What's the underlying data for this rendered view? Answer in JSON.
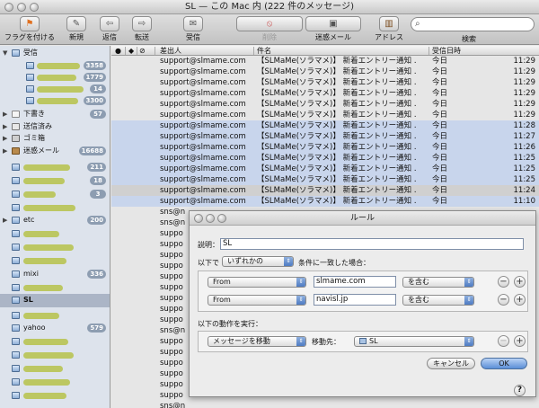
{
  "window": {
    "title": "SL — この Mac 内 (222 件のメッセージ)"
  },
  "toolbar": {
    "flag": "フラグを付ける",
    "new": "新規",
    "reply": "返信",
    "forward": "転送",
    "get_mail": "受信",
    "delete": "削除",
    "junk": "迷惑メール",
    "address": "アドレス",
    "search": "検索"
  },
  "sidebar": {
    "inbox": {
      "label": "受信",
      "accounts": [
        {
          "count": "3358"
        },
        {
          "count": "1779"
        },
        {
          "count": "14"
        },
        {
          "count": "3300"
        }
      ]
    },
    "drafts": {
      "label": "下書き",
      "count": "57"
    },
    "sent": {
      "label": "送信済み"
    },
    "trash": {
      "label": "ゴミ箱"
    },
    "junk": {
      "label": "迷惑メール",
      "count": "16688"
    },
    "folders": [
      {
        "count": "211"
      },
      {
        "count": "18"
      },
      {
        "count": "3"
      },
      {
        "label": "etc",
        "count": "200"
      },
      {
        "label": "mixi",
        "count": "336"
      },
      {
        "label": "SL"
      },
      {
        "label": "yahoo",
        "count": "579"
      }
    ]
  },
  "list": {
    "headers": {
      "from": "差出人",
      "subject": "件名",
      "date": "受信日時"
    },
    "rows": [
      {
        "from": "support@slmame.com",
        "subject": "【SLMaMe(ソラマメ)】 新着エントリー通知 …",
        "date": "今日",
        "time": "11:29"
      },
      {
        "from": "support@slmame.com",
        "subject": "【SLMaMe(ソラマメ)】 新着エントリー通知 …",
        "date": "今日",
        "time": "11:29"
      },
      {
        "from": "support@slmame.com",
        "subject": "【SLMaMe(ソラマメ)】 新着エントリー通知 …",
        "date": "今日",
        "time": "11:29"
      },
      {
        "from": "support@slmame.com",
        "subject": "【SLMaMe(ソラマメ)】 新着エントリー通知 …",
        "date": "今日",
        "time": "11:29"
      },
      {
        "from": "support@slmame.com",
        "subject": "【SLMaMe(ソラマメ)】 新着エントリー通知 …",
        "date": "今日",
        "time": "11:29"
      },
      {
        "from": "support@slmame.com",
        "subject": "【SLMaMe(ソラマメ)】 新着エントリー通知 …",
        "date": "今日",
        "time": "11:29"
      },
      {
        "from": "support@slmame.com",
        "subject": "【SLMaMe(ソラマメ)】 新着エントリー通知 …",
        "date": "今日",
        "time": "11:28"
      },
      {
        "from": "support@slmame.com",
        "subject": "【SLMaMe(ソラマメ)】 新着エントリー通知 …",
        "date": "今日",
        "time": "11:27"
      },
      {
        "from": "support@slmame.com",
        "subject": "【SLMaMe(ソラマメ)】 新着エントリー通知 …",
        "date": "今日",
        "time": "11:26"
      },
      {
        "from": "support@slmame.com",
        "subject": "【SLMaMe(ソラマメ)】 新着エントリー通知 …",
        "date": "今日",
        "time": "11:25"
      },
      {
        "from": "support@slmame.com",
        "subject": "【SLMaMe(ソラマメ)】 新着エントリー通知 …",
        "date": "今日",
        "time": "11:25"
      },
      {
        "from": "support@slmame.com",
        "subject": "【SLMaMe(ソラマメ)】 新着エントリー通知 …",
        "date": "今日",
        "time": "11:25"
      },
      {
        "from": "support@slmame.com",
        "subject": "【SLMaMe(ソラマメ)】 新着エントリー通知 …",
        "date": "今日",
        "time": "11:24"
      },
      {
        "from": "support@slmame.com",
        "subject": "【SLMaMe(ソラマメ)】 新着エントリー通知 …",
        "date": "今日",
        "time": "11:10"
      },
      {
        "from": "sns@n",
        "subject": "",
        "date": "",
        "time": ""
      },
      {
        "from": "sns@n",
        "subject": "",
        "date": "",
        "time": ""
      },
      {
        "from": "suppo",
        "subject": "",
        "date": "",
        "time": ""
      },
      {
        "from": "suppo",
        "subject": "",
        "date": "",
        "time": ""
      },
      {
        "from": "suppo",
        "subject": "",
        "date": "",
        "time": ""
      },
      {
        "from": "suppo",
        "subject": "",
        "date": "",
        "time": ""
      },
      {
        "from": "suppo",
        "subject": "",
        "date": "",
        "time": ""
      },
      {
        "from": "suppo",
        "subject": "",
        "date": "",
        "time": ""
      },
      {
        "from": "suppo",
        "subject": "",
        "date": "",
        "time": ""
      },
      {
        "from": "suppo",
        "subject": "",
        "date": "",
        "time": ""
      },
      {
        "from": "suppo",
        "subject": "",
        "date": "",
        "time": ""
      },
      {
        "from": "sns@n",
        "subject": "",
        "date": "",
        "time": ""
      },
      {
        "from": "suppo",
        "subject": "",
        "date": "",
        "time": ""
      },
      {
        "from": "suppo",
        "subject": "",
        "date": "",
        "time": ""
      },
      {
        "from": "suppo",
        "subject": "",
        "date": "",
        "time": ""
      },
      {
        "from": "suppo",
        "subject": "",
        "date": "",
        "time": ""
      },
      {
        "from": "suppo",
        "subject": "",
        "date": "",
        "time": ""
      },
      {
        "from": "suppo",
        "subject": "",
        "date": "",
        "time": ""
      },
      {
        "from": "sns@n",
        "subject": "",
        "date": "",
        "time": ""
      }
    ]
  },
  "rules_dialog": {
    "title": "ルール",
    "description_label": "説明：",
    "description_value": "SL",
    "if_prefix": "以下で",
    "match_mode": "いずれかの",
    "if_suffix": "条件に一致した場合：",
    "conditions": [
      {
        "field": "From",
        "value": "slmame.com",
        "op": "を含む"
      },
      {
        "field": "From",
        "value": "navisl.jp",
        "op": "を含む"
      }
    ],
    "actions_label": "以下の動作を実行：",
    "action": "メッセージを移動",
    "move_to_label": "移動先：",
    "move_to": "SL",
    "cancel": "キャンセル",
    "ok": "OK",
    "help": "?"
  }
}
